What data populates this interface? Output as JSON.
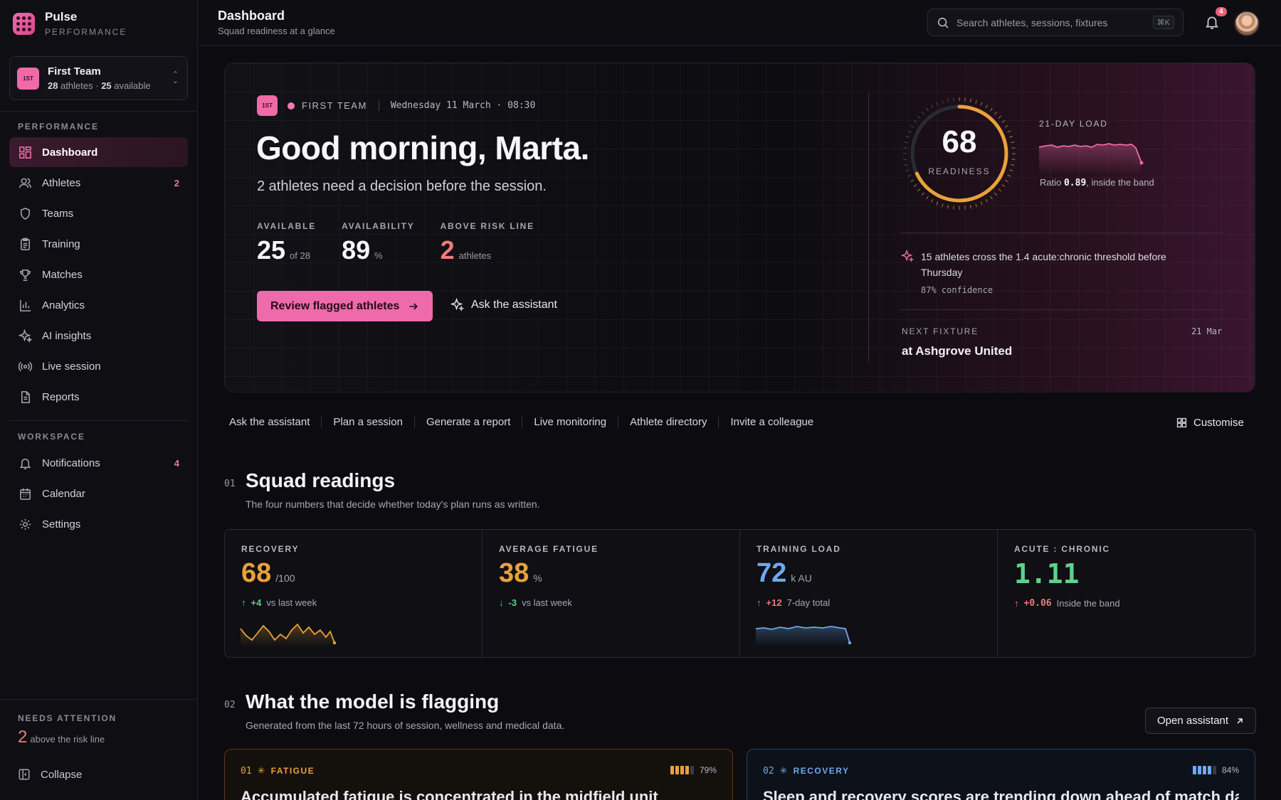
{
  "brand": {
    "name": "Pulse",
    "sub": "PERFORMANCE"
  },
  "team": {
    "badge": "1ST",
    "name": "First Team",
    "athletes": "28",
    "athletes_suffix": "athletes ·",
    "available": "25",
    "available_suffix": "available"
  },
  "sidebar": {
    "section_performance": "PERFORMANCE",
    "section_workspace": "WORKSPACE",
    "performance_items": [
      {
        "label": "Dashboard",
        "icon": "dashboard-icon",
        "active": true,
        "count": ""
      },
      {
        "label": "Athletes",
        "icon": "users-icon",
        "count": "2"
      },
      {
        "label": "Teams",
        "icon": "shield-icon",
        "count": ""
      },
      {
        "label": "Training",
        "icon": "clipboard-icon",
        "count": ""
      },
      {
        "label": "Matches",
        "icon": "trophy-icon",
        "count": ""
      },
      {
        "label": "Analytics",
        "icon": "bar-chart-icon",
        "count": ""
      },
      {
        "label": "AI insights",
        "icon": "sparkle-icon",
        "count": ""
      },
      {
        "label": "Live session",
        "icon": "broadcast-icon",
        "count": ""
      },
      {
        "label": "Reports",
        "icon": "document-icon",
        "count": ""
      }
    ],
    "workspace_items": [
      {
        "label": "Notifications",
        "icon": "bell-icon",
        "count": "4"
      },
      {
        "label": "Calendar",
        "icon": "calendar-icon",
        "count": ""
      },
      {
        "label": "Settings",
        "icon": "gear-icon",
        "count": ""
      }
    ],
    "needs_attention": {
      "label": "NEEDS ATTENTION",
      "value": "2",
      "suffix": "above the risk line"
    },
    "collapse_label": "Collapse"
  },
  "topbar": {
    "title": "Dashboard",
    "subtitle": "Squad readiness at a glance",
    "search_placeholder": "Search athletes, sessions, fixtures",
    "search_shortcut": "⌘K",
    "notification_count": "4"
  },
  "hero": {
    "badge": "1ST",
    "team_label": "FIRST TEAM",
    "date": "Wednesday 11 March · 08:30",
    "greeting": "Good morning, Marta.",
    "subtitle": "2 athletes need a decision before the session.",
    "stats": [
      {
        "label": "AVAILABLE",
        "value": "25",
        "suffix": "of 28"
      },
      {
        "label": "AVAILABILITY",
        "value": "89",
        "suffix": "%"
      },
      {
        "label": "ABOVE RISK LINE",
        "value": "2",
        "suffix": "athletes"
      }
    ],
    "primary_button": "Review flagged athletes",
    "ghost_button": "Ask the assistant",
    "readiness": {
      "value": "68",
      "label": "READINESS",
      "fraction": 0.68
    },
    "load": {
      "label": "21-DAY LOAD",
      "ratio_prefix": "Ratio",
      "ratio": "0.89",
      "ratio_suffix": ", inside the band"
    },
    "insight": {
      "text": "15 athletes cross the 1.4 acute:chronic threshold before Thursday",
      "confidence": "87% confidence"
    },
    "fixture": {
      "label": "NEXT FIXTURE",
      "date": "21 Mar",
      "name": "at Ashgrove United"
    }
  },
  "quick_actions": [
    "Ask the assistant",
    "Plan a session",
    "Generate a report",
    "Live monitoring",
    "Athlete directory",
    "Invite a colleague"
  ],
  "customise_label": "Customise",
  "section1": {
    "num": "01",
    "title": "Squad readings",
    "subtitle": "The four numbers that decide whether today's plan runs as written."
  },
  "readings": [
    {
      "label": "RECOVERY",
      "value": "68",
      "unit": "/100",
      "delta": "+4",
      "delta_dir": "up",
      "delta_note": "vs last week",
      "color": "#e8a23a",
      "delta_color": "#5fd08a"
    },
    {
      "label": "AVERAGE FATIGUE",
      "value": "38",
      "unit": "%",
      "delta": "-3",
      "delta_dir": "down",
      "delta_note": "vs last week",
      "color": "#e8a23a",
      "delta_color": "#5fd08a"
    },
    {
      "label": "TRAINING LOAD",
      "value": "72",
      "unit": "k AU",
      "delta": "+12",
      "delta_dir": "up",
      "delta_note": "7-day total",
      "color": "#6fa8f0",
      "delta_color": "#f07a7a"
    },
    {
      "label": "ACUTE : CHRONIC",
      "value": "1.11",
      "unit": "",
      "delta": "+0.06",
      "delta_dir": "up",
      "delta_note": "Inside the band",
      "color": "#5fd08a",
      "delta_color": "#f07a7a"
    }
  ],
  "section2": {
    "num": "02",
    "title": "What the model is flagging",
    "subtitle": "Generated from the last 72 hours of session, wellness and medical data.",
    "button": "Open assistant"
  },
  "flags": [
    {
      "num": "01",
      "tag": "FATIGUE",
      "confidence": "79%",
      "color": "#e8a23a",
      "text": "Accumulated fatigue is concentrated in the midfield unit"
    },
    {
      "num": "02",
      "tag": "RECOVERY",
      "confidence": "84%",
      "color": "#6fa8f0",
      "text": "Sleep and recovery scores are trending down ahead of match day"
    }
  ]
}
